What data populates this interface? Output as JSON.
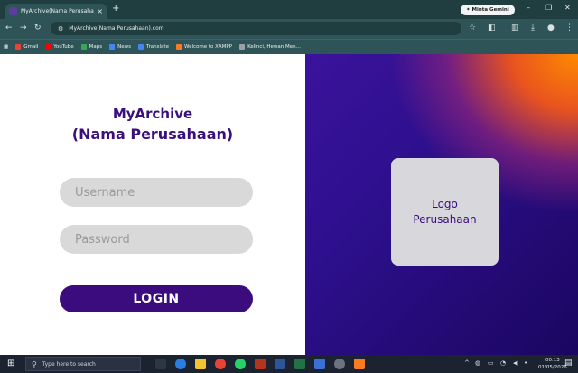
{
  "browser": {
    "tab_title": "MyArchive(Nama Perusahaan)",
    "tab_close": "×",
    "new_tab": "+",
    "gemini_label": "✦ Minta Gemini",
    "window_controls": {
      "minimize": "–",
      "restore": "❐",
      "close": "✕"
    },
    "url": "MyArchive(Nama Perusahaan).com",
    "bookmarks": [
      {
        "label": "Gmail",
        "color": "#ea4335"
      },
      {
        "label": "YouTube",
        "color": "#ff0000"
      },
      {
        "label": "Maps",
        "color": "#34a853"
      },
      {
        "label": "News",
        "color": "#4285f4"
      },
      {
        "label": "Translate",
        "color": "#4285f4"
      },
      {
        "label": "Welcome to XAMPP",
        "color": "#fb7a24"
      },
      {
        "label": "Kelinci, Hewan Men...",
        "color": "#9aa0a6"
      }
    ]
  },
  "page": {
    "brand_line1": "MyArchive",
    "brand_line2": "(Nama Perusahaan)",
    "username_placeholder": "Username",
    "password_placeholder": "Password",
    "login_label": "LOGIN",
    "logo_line1": "Logo",
    "logo_line2": "Perusahaan",
    "accent": "#3b0c7e"
  },
  "taskbar": {
    "search_placeholder": "Type here to search",
    "time": "00.13",
    "date": "01/05/2026"
  }
}
